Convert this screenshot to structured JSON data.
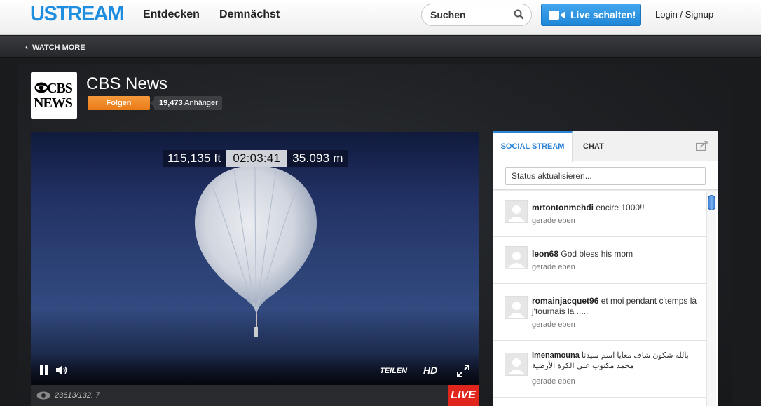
{
  "header": {
    "logo": "USTREAM",
    "nav": [
      "Entdecken",
      "Demnächst"
    ],
    "search_placeholder": "Suchen",
    "live_button": "Live schalten!",
    "login": "Login / Signup"
  },
  "watch_bar": {
    "label": "WATCH MORE"
  },
  "channel": {
    "logo_line1": "CBS",
    "logo_line2": "NEWS",
    "title": "CBS News",
    "follow_label": "Folgen",
    "followers_count": "19,473",
    "followers_label": "Anhänger"
  },
  "video": {
    "overlay_altitude_ft": "115,135 ft",
    "overlay_time": "02:03:41",
    "overlay_altitude_m": "35.093 m",
    "share_label": "TEILEN",
    "hd_label": "HD",
    "viewers_text": "23613/132. 7",
    "live_badge": "LIVE"
  },
  "social": {
    "tabs": [
      "SOCIAL STREAM",
      "CHAT"
    ],
    "status_placeholder": "Status aktualisieren...",
    "feed": [
      {
        "user": "mrtontonmehdi",
        "text": "encire 1000!!",
        "time": "gerade eben"
      },
      {
        "user": "leon68",
        "text": "God bless his mom",
        "time": "gerade eben"
      },
      {
        "user": "romainjacquet96",
        "text": "et moi pendant c'temps là j'tournais la .....",
        "time": "gerade eben"
      },
      {
        "user": "imenamouna",
        "text": "بالله شكون شاف معايا اسم سيدنا محمد مكتوب على الكرة الأرضية",
        "time": "gerade eben"
      }
    ]
  },
  "colors": {
    "brand": "#1e8fe0",
    "follow": "#ee8321",
    "live": "#e0261c",
    "tab_active": "#2a83d6"
  }
}
